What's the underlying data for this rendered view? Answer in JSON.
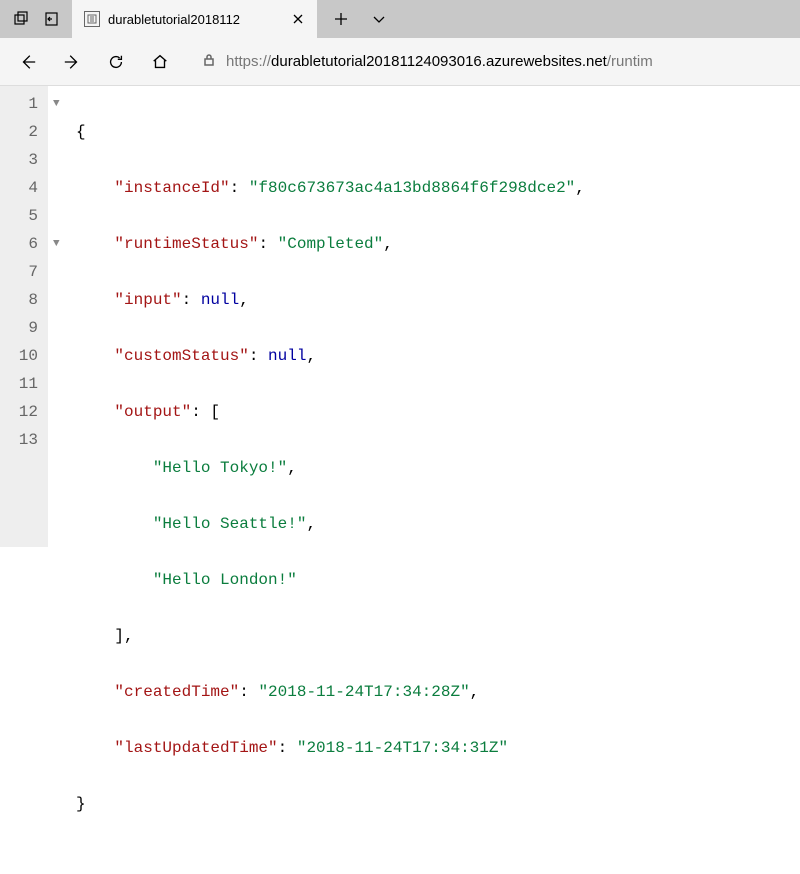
{
  "tab": {
    "title": "durabletutorial2018112"
  },
  "url": {
    "scheme": "https://",
    "host": "durabletutorial20181124093016.azurewebsites.net",
    "path": "/runtim"
  },
  "lines": [
    "1",
    "2",
    "3",
    "4",
    "5",
    "6",
    "7",
    "8",
    "9",
    "10",
    "11",
    "12",
    "13"
  ],
  "json": {
    "instanceId_key": "\"instanceId\"",
    "instanceId_val": "\"f80c673673ac4a13bd8864f6f298dce2\"",
    "runtimeStatus_key": "\"runtimeStatus\"",
    "runtimeStatus_val": "\"Completed\"",
    "input_key": "\"input\"",
    "input_val": "null",
    "customStatus_key": "\"customStatus\"",
    "customStatus_val": "null",
    "output_key": "\"output\"",
    "output_0": "\"Hello Tokyo!\"",
    "output_1": "\"Hello Seattle!\"",
    "output_2": "\"Hello London!\"",
    "createdTime_key": "\"createdTime\"",
    "createdTime_val": "\"2018-11-24T17:34:28Z\"",
    "lastUpdatedTime_key": "\"lastUpdatedTime\"",
    "lastUpdatedTime_val": "\"2018-11-24T17:34:31Z\""
  }
}
